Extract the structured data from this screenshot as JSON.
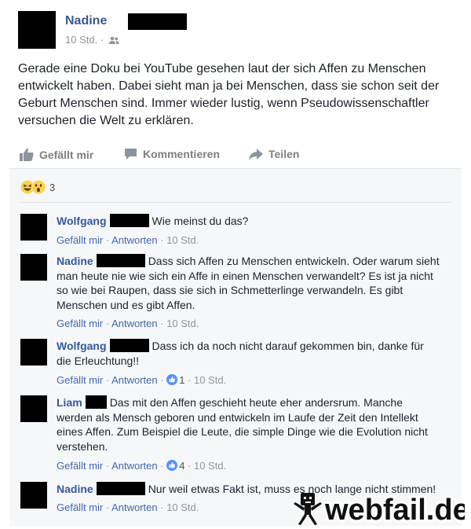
{
  "post": {
    "author": "Nadine",
    "time": "10 Std. ·",
    "privacy_icon": "friends-icon",
    "text": "Gerade eine Doku bei YouTube gesehen laut der sich Affen zu Menschen entwickelt haben. Dabei sieht man ja bei Menschen, dass sie schon seit der Geburt Menschen sind. Immer wieder lustig, wenn Pseudowissenschaftler versuchen die Welt zu erklären."
  },
  "actions": {
    "like": "Gefällt mir",
    "comment": "Kommentieren",
    "share": "Teilen"
  },
  "reactions": {
    "icons": [
      "laughing-emoji-icon",
      "wow-emoji-icon"
    ],
    "count": "3"
  },
  "comment_links": {
    "like": "Gefällt mir",
    "reply": "Antworten"
  },
  "comments": [
    {
      "author": "Wolfgang",
      "text": "Wie meinst du das?",
      "time": "10 Std.",
      "likes": ""
    },
    {
      "author": "Nadine",
      "text": "Dass sich Affen zu Menschen entwickeln. Oder warum sieht man heute nie wie sich ein Affe in einen Menschen verwandelt? Es ist ja nicht so wie bei Raupen, dass sie sich in Schmetterlinge verwandeln. Es gibt Menschen und es gibt Affen.",
      "time": "10 Std.",
      "likes": ""
    },
    {
      "author": "Wolfgang",
      "text": "Dass ich da noch nicht darauf gekommen bin, danke für die Erleuchtung!!",
      "time": "10 Std.",
      "likes": "1"
    },
    {
      "author": "Liam",
      "text": "Das mit den Affen geschieht heute eher andersrum. Manche werden als Mensch geboren und entwickeln im Laufe der Zeit den Intellekt eines Affen. Zum Beispiel die Leute, die simple Dinge wie die Evolution nicht verstehen.",
      "time": "10 Std.",
      "likes": "4"
    },
    {
      "author": "Nadine",
      "text": "Nur weil etwas Fakt ist, muss es noch lange nicht stimmen!",
      "time": "10 Std.",
      "likes": ""
    }
  ],
  "watermark": {
    "text": "webfail.de"
  },
  "colors": {
    "link_blue": "#365899",
    "action_blue": "#4267b2",
    "meta_gray": "#90949c",
    "comments_bg": "#f6f7f9",
    "watermark_dark": "#111111"
  }
}
